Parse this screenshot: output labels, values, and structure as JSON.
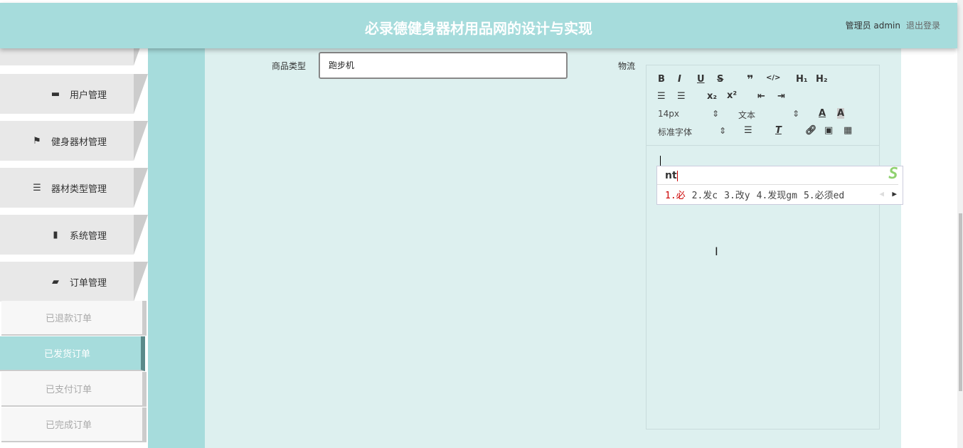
{
  "header": {
    "title": "必录德健身器材用品网的设计与实现",
    "user": "管理员 admin",
    "logout": "退出登录"
  },
  "sidebar": {
    "items": [
      {
        "label": "用户管理",
        "icon": "user-icon",
        "glyph": "▬"
      },
      {
        "label": "健身器材管理",
        "icon": "flag-icon",
        "glyph": "⚑"
      },
      {
        "label": "器材类型管理",
        "icon": "sliders-icon",
        "glyph": "☰"
      },
      {
        "label": "系统管理",
        "icon": "bar-chart-icon",
        "glyph": "▮"
      },
      {
        "label": "订单管理",
        "icon": "wallet-icon",
        "glyph": "▰"
      }
    ],
    "subitems": [
      {
        "label": "已退款订单"
      },
      {
        "label": "已发货订单",
        "active": true
      },
      {
        "label": "已支付订单"
      },
      {
        "label": "已完成订单"
      }
    ]
  },
  "form": {
    "type_label": "商品类型",
    "type_value": "跑步机",
    "logistics_label": "物流"
  },
  "editor": {
    "font_size": "14px",
    "text_style": "文本",
    "font_family": "标准字体"
  },
  "ime": {
    "composition": "nt",
    "candidates": [
      "1.必",
      "2.发c",
      "3.改y",
      "4.发现gm",
      "5.必须ed"
    ]
  },
  "colors": {
    "accent": "#a6dcdc",
    "content_bg": "#ddf0ef",
    "ime_highlight": "#cc0000"
  }
}
